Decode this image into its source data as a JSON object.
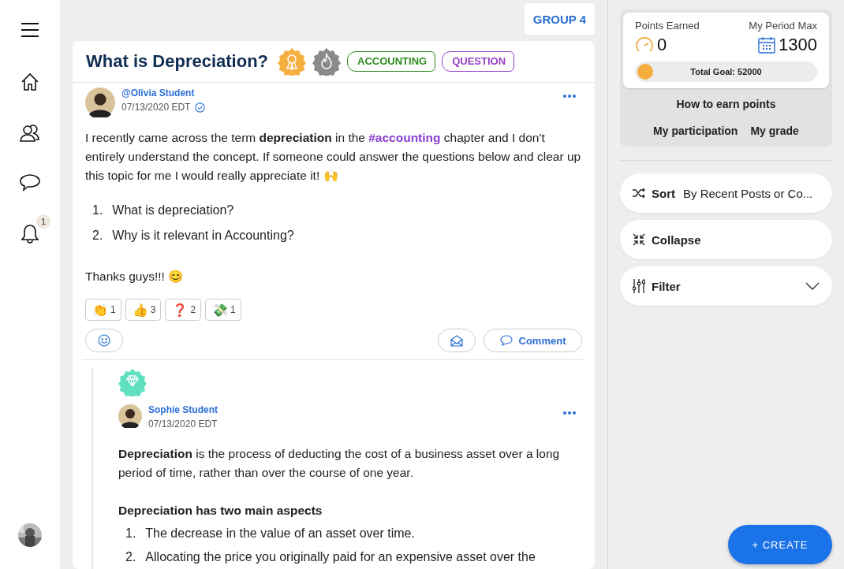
{
  "nav": {
    "items": [
      {
        "kind": "menu"
      },
      {
        "kind": "home"
      },
      {
        "kind": "people"
      },
      {
        "kind": "chat"
      },
      {
        "kind": "bell",
        "badge": "1"
      }
    ]
  },
  "group_badge": "GROUP 4",
  "post": {
    "title": "What is Depreciation?",
    "awards": [
      {
        "kind": "ribbon",
        "color": "#f5b041"
      },
      {
        "kind": "fire",
        "color": "#8a8a8a"
      }
    ],
    "tags": [
      {
        "label": "ACCOUNTING",
        "color": "#2e8b1e"
      },
      {
        "label": "QUESTION",
        "color": "#9b3fc9"
      }
    ],
    "author": {
      "name": "@Olivia Student",
      "date": "07/13/2020 EDT",
      "verified": true
    },
    "intro": [
      {
        "kind": "text",
        "text": "I recently came across the term "
      },
      {
        "kind": "bold",
        "text": "depreciation"
      },
      {
        "kind": "text",
        "text": " in the "
      },
      {
        "kind": "hashtag",
        "text": "#accounting"
      },
      {
        "kind": "text",
        "text": " chapter and I don't entirely understand the concept. If someone could answer the questions below and clear up this topic for me I would really appreciate it! 🙌"
      }
    ],
    "questions": [
      {
        "number": "1.",
        "text": "What is depreciation?"
      },
      {
        "number": "2.",
        "text": "Why is it relevant in Accounting?"
      }
    ],
    "closing": "Thanks guys!!! 😊",
    "reactions": [
      {
        "emoji": "👏",
        "count": "1"
      },
      {
        "emoji": "👍",
        "count": "3"
      },
      {
        "emoji": "❓",
        "count": "2"
      },
      {
        "emoji": "💸",
        "count": "1"
      }
    ],
    "comment_label": "Comment"
  },
  "reply": {
    "award": {
      "kind": "diamond",
      "color": "#5fe0c0"
    },
    "author": {
      "name": "Sophie Student",
      "date": "07/13/2020 EDT",
      "verified": false
    },
    "text": "**Depreciation** is the process of deducting the cost of a business asset over a long period of time, rather than over the course of one year.",
    "heading": "Depreciation has two main aspects",
    "points": [
      {
        "number": "1.",
        "text": "The decrease in the value of an asset over time."
      },
      {
        "number": "2.",
        "text": "Allocating the price you originally paid for an expensive asset over the"
      }
    ]
  },
  "points": {
    "earned_label": "Points Earned",
    "earned": "0",
    "max_label": "My Period Max",
    "max": "1300",
    "goal": "Total Goal: 52000",
    "level": 0,
    "links": [
      "How to earn points",
      "My participation",
      "My grade"
    ]
  },
  "controls": [
    {
      "kind": "sort",
      "label": "Sort",
      "value": "By Recent Posts or Co..."
    },
    {
      "kind": "collapse",
      "label": "Collapse"
    },
    {
      "kind": "filter",
      "label": "Filter"
    }
  ],
  "create_label": "+ CREATE"
}
